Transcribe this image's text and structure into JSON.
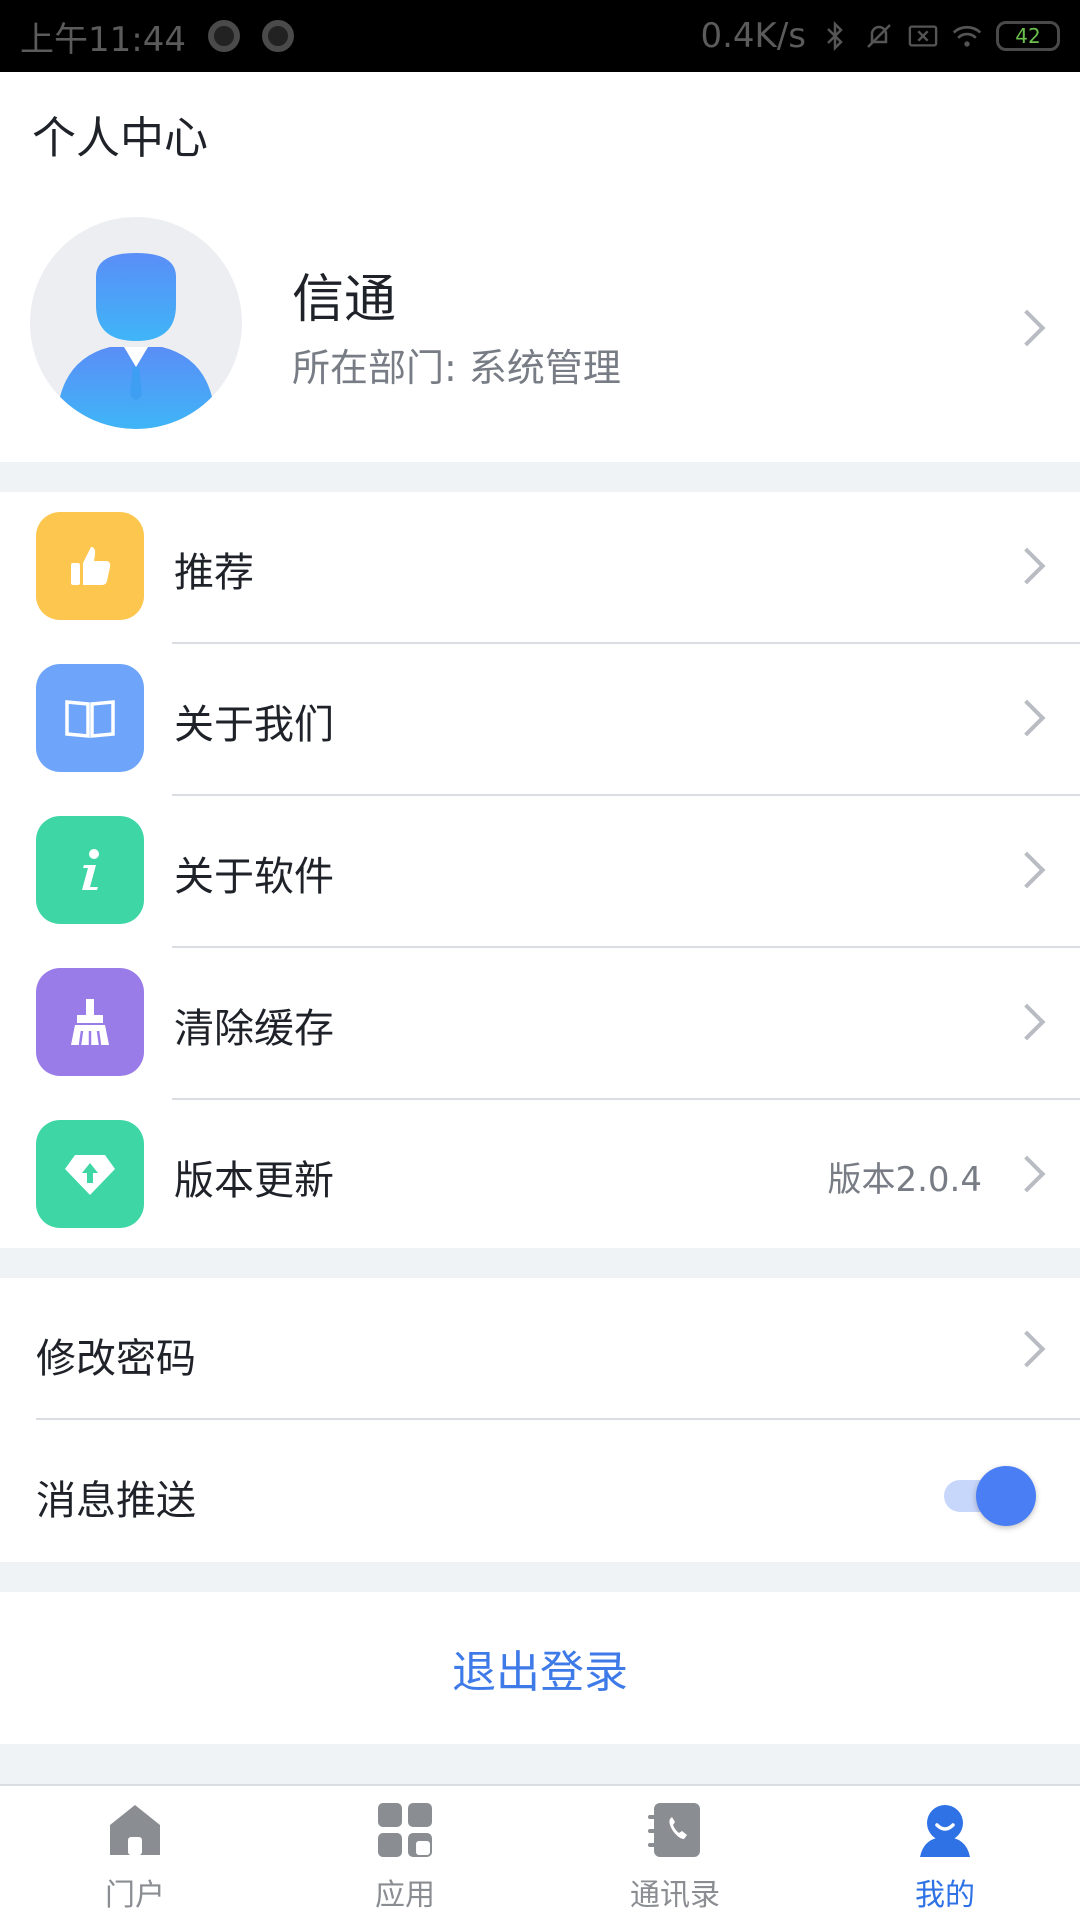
{
  "status_bar": {
    "time": "上午11:44",
    "speed": "0.4K/s",
    "battery": "42"
  },
  "header": {
    "title": "个人中心"
  },
  "profile": {
    "name": "信通",
    "department": "所在部门: 系统管理"
  },
  "menu": {
    "items": [
      {
        "label": "推荐",
        "icon": "thumbs-up-icon",
        "color": "#fdc64e"
      },
      {
        "label": "关于我们",
        "icon": "book-icon",
        "color": "#6ea4fa"
      },
      {
        "label": "关于软件",
        "icon": "info-icon",
        "color": "#3ed6a4"
      },
      {
        "label": "清除缓存",
        "icon": "broom-icon",
        "color": "#9a7ce9"
      },
      {
        "label": "版本更新",
        "icon": "update-icon",
        "color": "#3ed6a4",
        "value": "版本2.0.4"
      }
    ]
  },
  "settings": {
    "change_password": "修改密码",
    "push_notifications": "消息推送",
    "push_enabled": true
  },
  "logout": {
    "label": "退出登录"
  },
  "tabbar": {
    "tabs": [
      {
        "label": "门户",
        "icon": "home-icon",
        "active": false
      },
      {
        "label": "应用",
        "icon": "apps-icon",
        "active": false
      },
      {
        "label": "通讯录",
        "icon": "contacts-icon",
        "active": false
      },
      {
        "label": "我的",
        "icon": "profile-icon",
        "active": true
      }
    ],
    "active_color": "#2f72e6",
    "inactive_color": "#8a8d92"
  }
}
